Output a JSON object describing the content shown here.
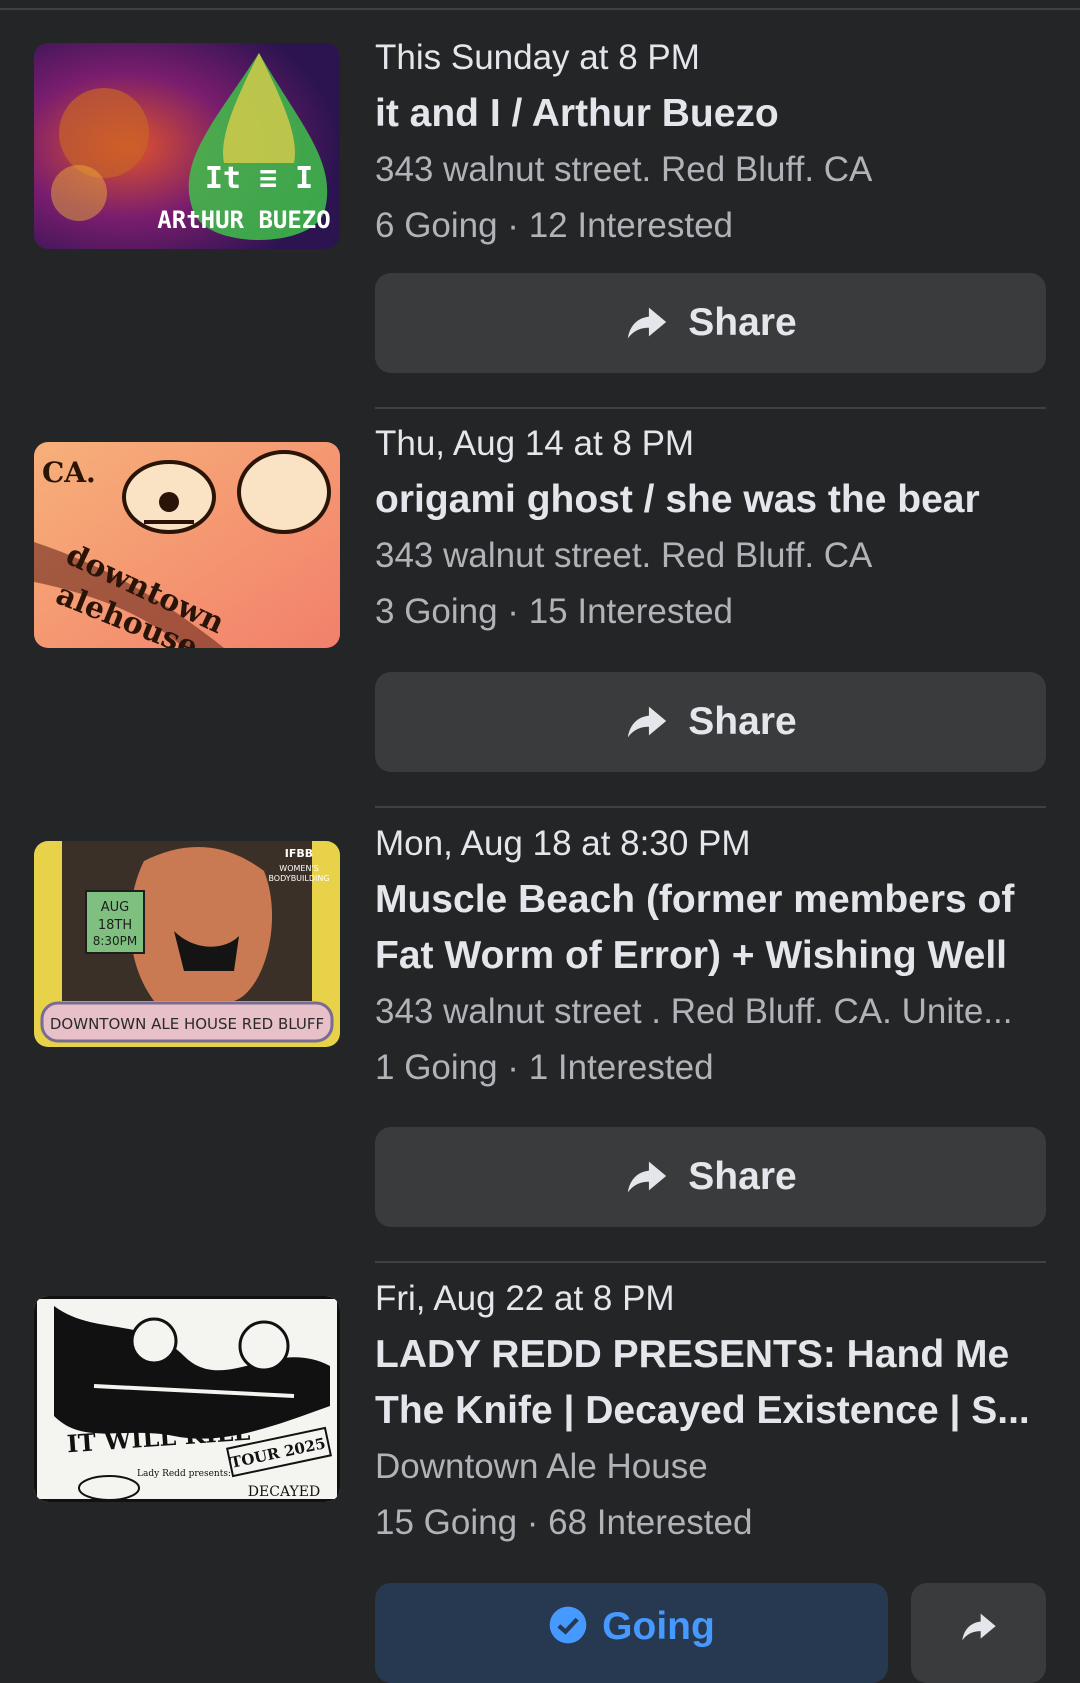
{
  "events": [
    {
      "date": "This Sunday at 8 PM",
      "title": "it and I / Arthur Buezo",
      "location": "343 walnut street. Red Bluff. CA",
      "stats": "6 Going · 12 Interested",
      "share_label": "Share",
      "poster_text": "It AND I ARtHUR BUEZO"
    },
    {
      "date": "Thu, Aug 14 at 8 PM",
      "title": "origami ghost / she was the bear",
      "location": "343 walnut street. Red Bluff. CA",
      "stats": "3 Going · 15 Interested",
      "share_label": "Share",
      "poster_text": "CA. downtown alehouse"
    },
    {
      "date": "Mon, Aug 18 at 8:30 PM",
      "title": "Muscle Beach (former members of Fat Worm of Error) + Wishing Well",
      "location": "343 walnut street . Red Bluff. CA. Unite...",
      "stats": "1 Going · 1 Interested",
      "share_label": "Share",
      "poster_text": "DOWNTOWN ALE HOUSE RED BLUFF",
      "poster_badge": "IFBB WOMEN'S BODYBUILDING",
      "poster_date": "AUG 18TH 8:30PM"
    },
    {
      "date": "Fri, Aug 22 at 8 PM",
      "title": "LADY REDD PRESENTS: Hand Me The Knife | Decayed Existence | S...",
      "location": "Downtown Ale House",
      "stats": "15 Going · 68 Interested",
      "join_label": "Going",
      "poster_text": "IT WILL KILL",
      "poster_tour": "TOUR 2025",
      "poster_presents": "Lady Redd presents:"
    }
  ],
  "icons": {
    "share": "share-arrow-icon",
    "join": "check-circle-icon",
    "more": "share-arrow-icon"
  },
  "colors": {
    "background": "#242526",
    "button": "#3a3b3c",
    "text_primary": "#e4e6eb",
    "text_secondary": "#b0b3b8",
    "accent": "#4599ff"
  }
}
